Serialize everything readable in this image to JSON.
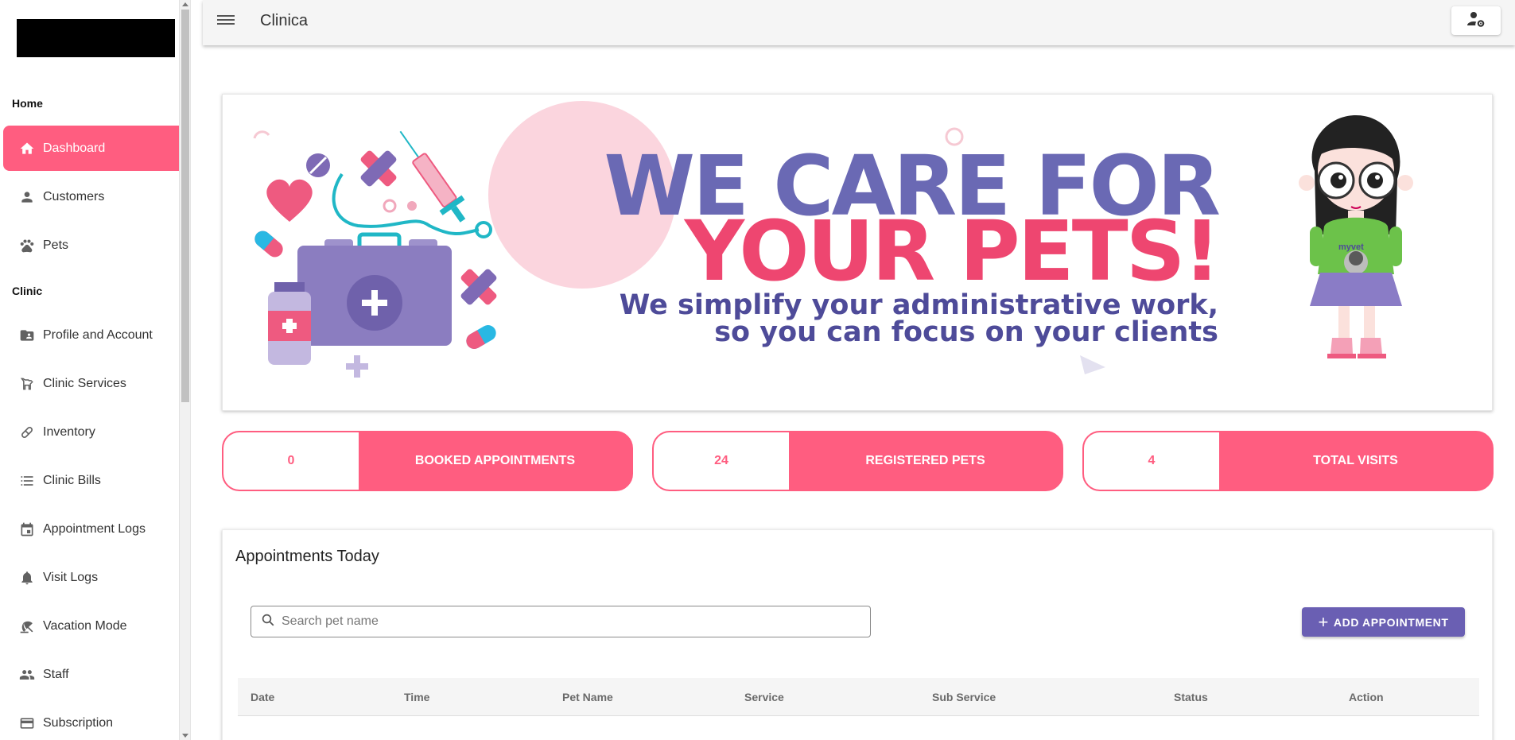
{
  "app": {
    "title": "Clinica"
  },
  "sidebar": {
    "sections": [
      {
        "label": "Home"
      },
      {
        "label": "Clinic"
      }
    ],
    "items": [
      {
        "label": "Dashboard",
        "icon": "home-icon",
        "active": true
      },
      {
        "label": "Customers",
        "icon": "person-icon"
      },
      {
        "label": "Pets",
        "icon": "paw-icon"
      },
      {
        "label": "Profile and Account",
        "icon": "folder-account-icon"
      },
      {
        "label": "Clinic Services",
        "icon": "dog-service-icon"
      },
      {
        "label": "Inventory",
        "icon": "pill-icon"
      },
      {
        "label": "Clinic Bills",
        "icon": "list-icon"
      },
      {
        "label": "Appointment Logs",
        "icon": "calendar-icon"
      },
      {
        "label": "Visit Logs",
        "icon": "bell-icon"
      },
      {
        "label": "Vacation Mode",
        "icon": "beach-umbrella-icon"
      },
      {
        "label": "Staff",
        "icon": "people-icon"
      },
      {
        "label": "Subscription",
        "icon": "credit-card-icon"
      }
    ]
  },
  "banner": {
    "line1": "WE CARE FOR",
    "line2": "YOUR PETS!",
    "line3": "We simplify your administrative work,",
    "line4": "so you can focus on your clients",
    "mascot_text": "myvet",
    "colors": {
      "purple": "#6a69b4",
      "pink": "#ee4670",
      "dark_purple": "#4e4b99"
    }
  },
  "stats": [
    {
      "value": "0",
      "label": "BOOKED APPOINTMENTS"
    },
    {
      "value": "24",
      "label": "REGISTERED PETS"
    },
    {
      "value": "4",
      "label": "TOTAL VISITS"
    }
  ],
  "appointments": {
    "title": "Appointments Today",
    "search_placeholder": "Search pet name",
    "add_button": "ADD APPOINTMENT",
    "columns": [
      "Date",
      "Time",
      "Pet Name",
      "Service",
      "Sub Service",
      "Status",
      "Action"
    ]
  },
  "colors": {
    "accent": "#ff5d80",
    "button": "#6a5fb3"
  }
}
